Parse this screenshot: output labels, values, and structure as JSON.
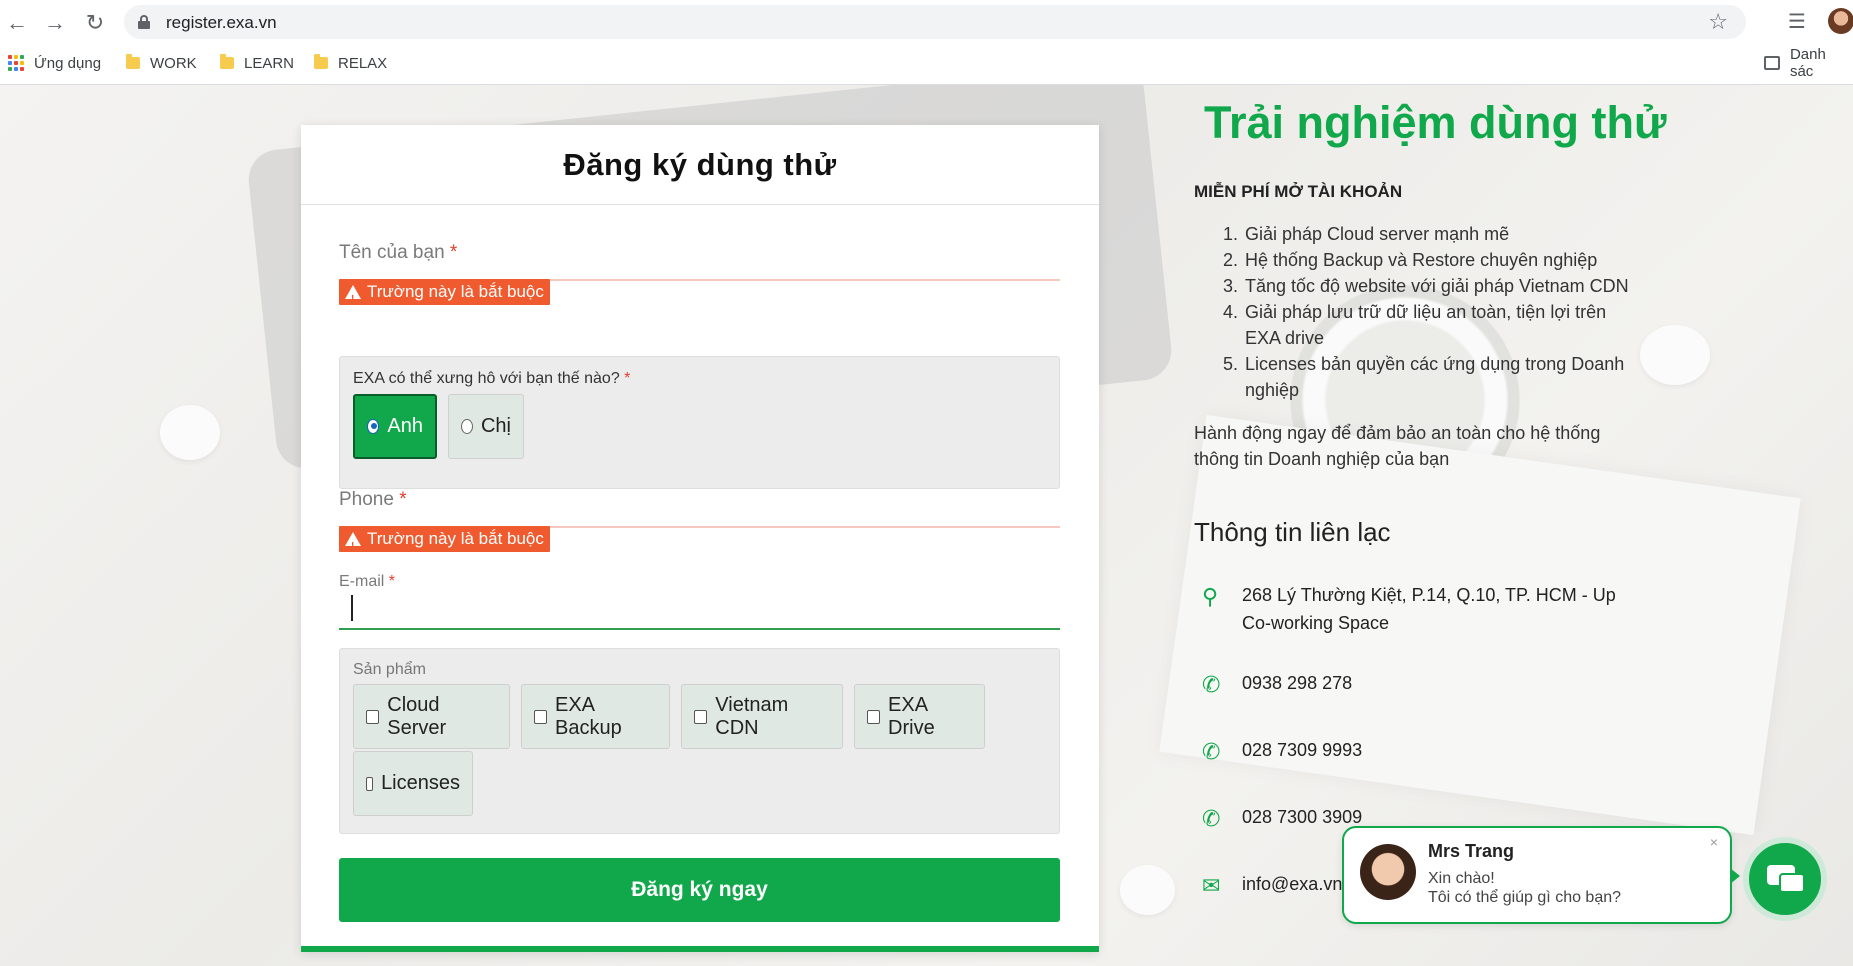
{
  "browser": {
    "url": "register.exa.vn",
    "bookmarks": [
      "Ứng dụng",
      "WORK",
      "LEARN",
      "RELAX"
    ],
    "reading_list": "Danh sác"
  },
  "form": {
    "title": "Đăng ký dùng thử",
    "name_label": "Tên của bạn",
    "required_mark": "*",
    "error_text": "Trường này là bắt buộc",
    "salutation_label": "EXA có thể xưng hô với bạn thế nào?",
    "salutation_options": [
      "Anh",
      "Chị"
    ],
    "salutation_selected": "Anh",
    "phone_label": "Phone",
    "email_label": "E-mail",
    "products_label": "Sản phẩm",
    "products": [
      "Cloud Server",
      "EXA Backup",
      "Vietnam CDN",
      "EXA Drive",
      "Licenses"
    ],
    "submit_label": "Đăng ký ngay"
  },
  "info": {
    "title": "Trải nghiệm dùng thử",
    "subtitle": "MIỄN PHÍ MỞ TÀI KHOẢN",
    "benefits": [
      "Giải pháp Cloud server mạnh mẽ",
      "Hệ thống Backup và Restore chuyên nghiệp",
      "Tăng tốc độ website với giải pháp Vietnam CDN",
      "Giải pháp lưu trữ dữ liệu an toàn, tiện lợi trên EXA drive",
      "Licenses bản quyền các ứng dụng trong Doanh nghiệp"
    ],
    "cta": "Hành động ngay để đảm bảo an toàn cho hệ thống thông tin Doanh nghiệp của bạn",
    "contact_title": "Thông tin liên lạc",
    "address": "268 Lý Thường Kiệt, P.14, Q.10, TP. HCM - Up Co-working Space",
    "phone1": "0938 298 278",
    "phone2": "028 7309 9993",
    "phone3": "028 7300 3909",
    "email": "info@exa.vn"
  },
  "chat": {
    "name": "Mrs Trang",
    "line1": "Xin chào!",
    "line2": "Tôi có thể giúp gì cho bạn?",
    "close": "×"
  },
  "colors": {
    "brand_green": "#10a84b",
    "error_orange": "#ef5a2f"
  },
  "icons": {
    "address": "map-pin-icon",
    "phone": "phone-icon",
    "email": "mail-icon",
    "chat": "chat-icon"
  }
}
